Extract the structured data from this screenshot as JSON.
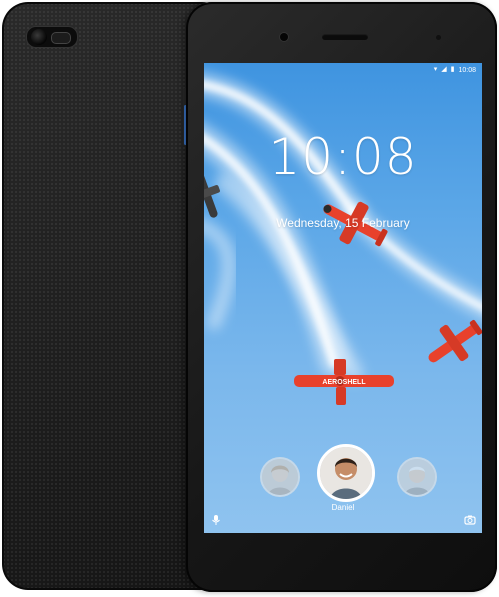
{
  "status_bar": {
    "time": "10:08",
    "icons": [
      "wifi-icon",
      "signal-icon",
      "battery-icon"
    ]
  },
  "lock_screen": {
    "clock": "10:08",
    "date": "Wednesday, 15 February"
  },
  "users": {
    "selected_name": "Daniel",
    "avatars": [
      "user-avatar-left",
      "user-avatar-daniel",
      "user-avatar-right"
    ]
  },
  "shortcuts": {
    "left_icon": "microphone-icon",
    "right_icon": "camera-icon"
  },
  "wallpaper": {
    "plane_livery_text": "AEROSHELL"
  },
  "colors": {
    "sky": "#5aa6e7",
    "plane_red": "#e8412c",
    "device_body": "#1c1c1c",
    "accent_button": "#3d7bd1"
  }
}
